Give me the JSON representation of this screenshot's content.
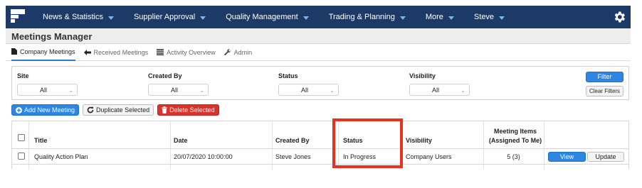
{
  "nav": {
    "items": [
      {
        "label": "News & Statistics"
      },
      {
        "label": "Supplier Approval"
      },
      {
        "label": "Quality Management"
      },
      {
        "label": "Trading & Planning"
      },
      {
        "label": "More"
      },
      {
        "label": "Steve"
      }
    ],
    "settings_icon": "gear-icon"
  },
  "page": {
    "title": "Meetings Manager"
  },
  "tabs": [
    {
      "label": "Company Meetings",
      "icon": "document-icon",
      "active": true
    },
    {
      "label": "Received Meetings",
      "icon": "arrow-left-icon",
      "active": false
    },
    {
      "label": "Activity Overview",
      "icon": "list-icon",
      "active": false
    },
    {
      "label": "Admin",
      "icon": "wrench-icon",
      "active": false
    }
  ],
  "filters": {
    "site": {
      "label": "Site",
      "value": "All"
    },
    "created_by": {
      "label": "Created By",
      "value": "All"
    },
    "status": {
      "label": "Status",
      "value": "All"
    },
    "visibility": {
      "label": "Visibility",
      "value": "All"
    },
    "filter_button": "Filter",
    "clear_button": "Clear Filters"
  },
  "actions": {
    "add": "Add New Meeting",
    "duplicate": "Duplicate Selected",
    "delete": "Delete Selected"
  },
  "table": {
    "headers": {
      "title": "Title",
      "date": "Date",
      "created_by": "Created By",
      "status": "Status",
      "visibility": "Visibility",
      "items_line1": "Meeting Items",
      "items_line2": "(Assigned To Me)"
    },
    "rows": [
      {
        "title": "Quality Action Plan",
        "date": "20/07/2020 10:00:00",
        "created_by": "Steve Jones",
        "status": "In Progress",
        "visibility": "Company Users",
        "items": "5 (3)",
        "view_label": "View",
        "update_label": "Update"
      }
    ]
  },
  "colors": {
    "nav_bg": "#1d3a66",
    "primary": "#2d86e0",
    "danger": "#d9342b",
    "highlight": "#e8321f"
  }
}
